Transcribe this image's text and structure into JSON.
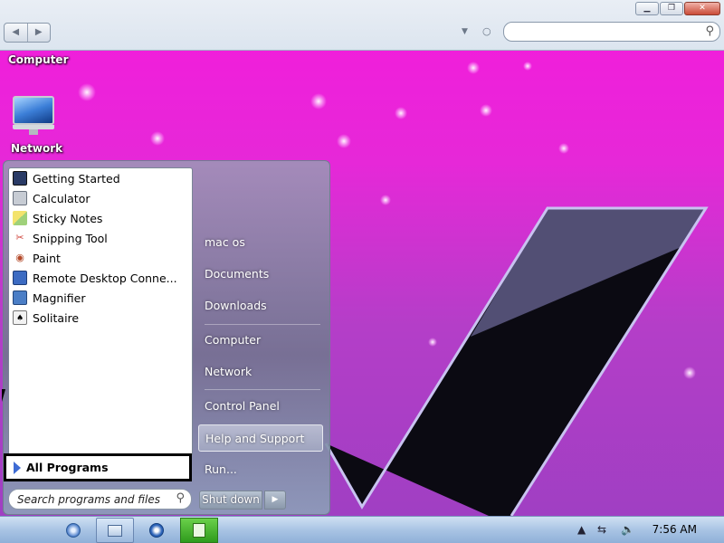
{
  "window": {
    "buttons": [
      "minimize",
      "maximize",
      "close"
    ],
    "nav": {
      "back_icon": "left-arrow-icon",
      "forward_icon": "right-arrow-icon"
    },
    "search": {
      "placeholder": ""
    }
  },
  "desktop": {
    "icons": [
      {
        "label": "Computer"
      },
      {
        "label": "Network"
      }
    ]
  },
  "start_menu": {
    "programs": [
      {
        "label": "Getting Started",
        "icon": "getting-started-icon",
        "color": "#2a3b66"
      },
      {
        "label": "Calculator",
        "icon": "calculator-icon",
        "color": "#8c95a3"
      },
      {
        "label": "Sticky Notes",
        "icon": "sticky-notes-icon",
        "color": "#e9dd66"
      },
      {
        "label": "Snipping Tool",
        "icon": "snipping-tool-icon",
        "color": "#d0453c"
      },
      {
        "label": "Paint",
        "icon": "paint-icon",
        "color": "#b44a2a"
      },
      {
        "label": "Remote Desktop Conne...",
        "icon": "remote-desktop-icon",
        "color": "#3c6bc2"
      },
      {
        "label": "Magnifier",
        "icon": "magnifier-icon",
        "color": "#4b7ec6"
      },
      {
        "label": "Solitaire",
        "icon": "solitaire-icon",
        "color": "#e7e7e7"
      }
    ],
    "all_programs": "All Programs",
    "search_placeholder": "Search programs and files",
    "right_items": [
      {
        "label": "mac os"
      },
      {
        "label": "Documents"
      },
      {
        "label": "Downloads"
      },
      {
        "label": "Computer"
      },
      {
        "label": "Network"
      },
      {
        "label": "Control Panel"
      },
      {
        "label": "Help and Support",
        "highlighted": true
      },
      {
        "label": "Run..."
      }
    ],
    "shutdown": "Shut down"
  },
  "taskbar": {
    "items": [
      {
        "icon": "apple-start-icon"
      },
      {
        "icon": "browser-globe-icon"
      },
      {
        "icon": "explorer-window-icon",
        "active": true
      },
      {
        "icon": "quicktime-icon"
      },
      {
        "icon": "green-app-icon"
      }
    ],
    "tray": [
      "show-hidden-icons-icon",
      "network-icon",
      "volume-muted-icon"
    ],
    "clock": "7:56 AM"
  },
  "colors": {
    "wallpaper_top": "#f41bdc",
    "wallpaper_bottom": "#9d3fc2",
    "v_stroke": "#c9c3f0",
    "taskbar": "#a9c4e4"
  }
}
